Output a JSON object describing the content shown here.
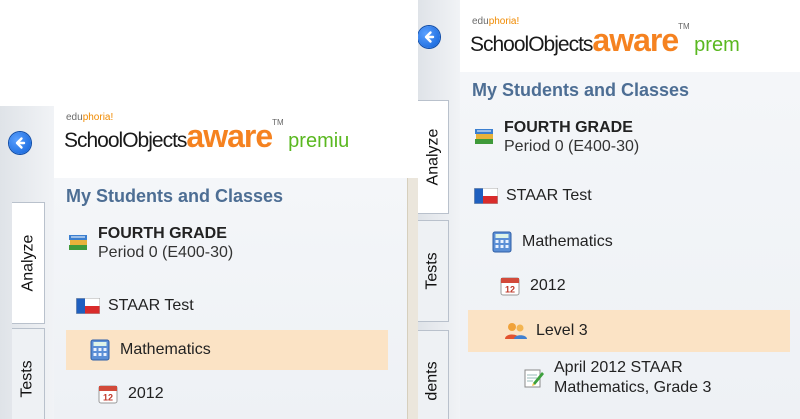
{
  "brand": {
    "edu_prefix": "edu",
    "edu_highlight": "phoria!",
    "school": "SchoolObjects",
    "aware": "aware",
    "tm": "TM",
    "premium_left": "premiu",
    "premium_right": "prem"
  },
  "tabs": {
    "analyze": "Analyze",
    "tests": "Tests",
    "students_partial": "dents"
  },
  "section_title": "My Students and Classes",
  "class": {
    "name": "FOURTH GRADE",
    "period": "Period 0 (E400-30)"
  },
  "tree": {
    "test": "STAAR Test",
    "subject": "Mathematics",
    "year": "2012",
    "year_icon_text": "12",
    "level": "Level 3",
    "assessment_line1": "April 2012 STAAR",
    "assessment_line2": "Mathematics, Grade 3"
  },
  "colors": {
    "accent_orange": "#f58220",
    "premium_green": "#5ab820",
    "section_blue": "#4d6e94",
    "selected_bg": "#fbe3c5"
  }
}
